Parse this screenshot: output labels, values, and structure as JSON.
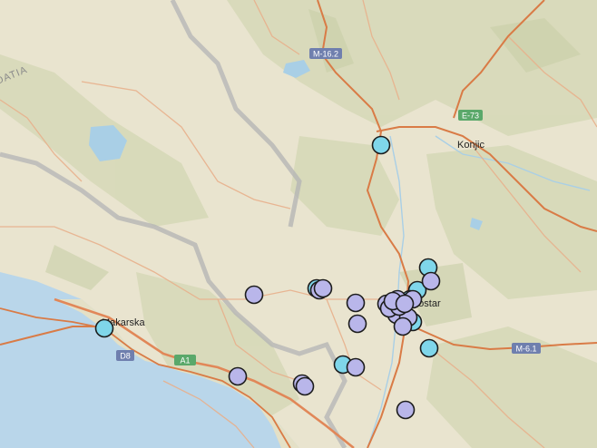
{
  "map": {
    "colors": {
      "land": "#e9e4cf",
      "sea": "#b9d6ea",
      "highway": "#d97b46",
      "road": "#e4a07a",
      "border": "#b6b6b6",
      "marker_blue": "#7fd6ea",
      "marker_purple": "#b9b6ea",
      "lake": "#a9cfe6"
    },
    "labels": {
      "city_mostar": "Mostar",
      "city_konjic": "Konjic",
      "city_makarska": "Makarska",
      "region_croatia": "CROATIA"
    },
    "road_shields": {
      "m16_2": "M-16.2",
      "e73": "E-73",
      "m6_1": "M-6.1",
      "a1": "A1",
      "d8": "D8"
    },
    "markers_blue": [
      1,
      2,
      3,
      4,
      5,
      6,
      7,
      8,
      9,
      10
    ],
    "markers_purple": [
      1,
      2,
      3,
      4,
      5,
      6,
      7,
      8,
      9,
      10,
      11,
      12,
      13,
      14,
      15,
      16,
      17,
      18,
      19,
      20,
      21,
      22,
      23
    ]
  }
}
